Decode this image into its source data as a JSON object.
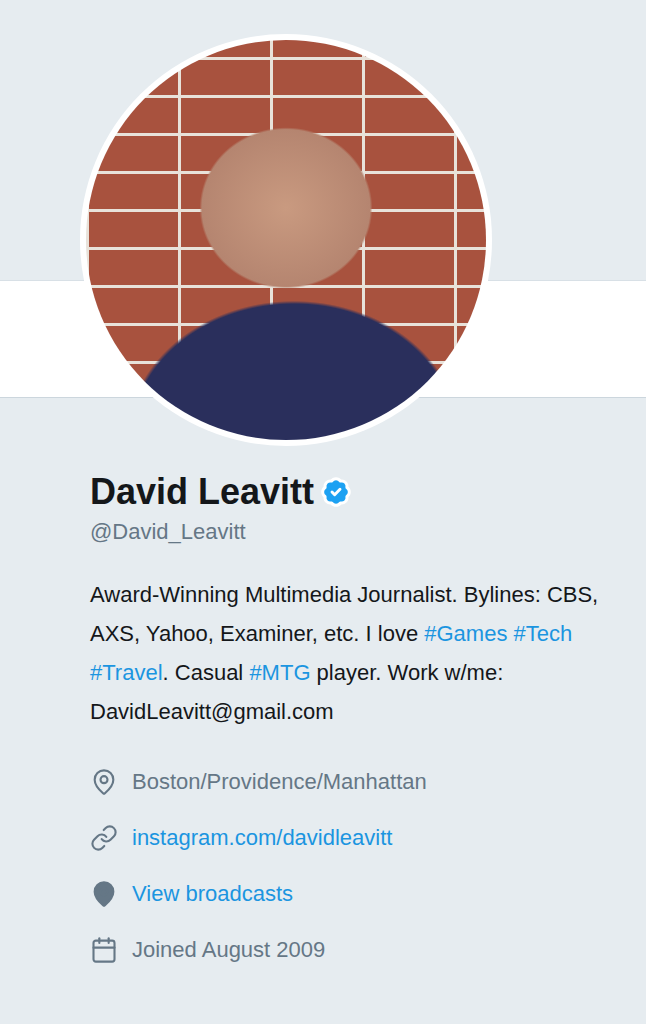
{
  "profile": {
    "name": "David Leavitt",
    "verified": true,
    "handle": "@David_Leavitt",
    "bio": [
      {
        "kind": "text",
        "text": "Award-Winning Multimedia Journalist. Bylines: CBS, AXS, Yahoo, Examiner, etc. I love "
      },
      {
        "kind": "hashtag",
        "text": "#Games"
      },
      {
        "kind": "text",
        "text": " "
      },
      {
        "kind": "hashtag",
        "text": "#Tech"
      },
      {
        "kind": "text",
        "text": " "
      },
      {
        "kind": "hashtag",
        "text": "#Travel"
      },
      {
        "kind": "text",
        "text": ". Casual "
      },
      {
        "kind": "hashtag",
        "text": "#MTG"
      },
      {
        "kind": "text",
        "text": " player. Work w/me: DavidLeavitt@gmail.com"
      }
    ],
    "meta": [
      {
        "kind": "location",
        "text": "Boston/Providence/Manhattan",
        "link": false
      },
      {
        "kind": "url",
        "text": "instagram.com/davidleavitt",
        "link": true
      },
      {
        "kind": "broadcasts",
        "text": "View broadcasts",
        "link": true
      },
      {
        "kind": "joined",
        "text": "Joined August 2009",
        "link": false
      }
    ]
  }
}
